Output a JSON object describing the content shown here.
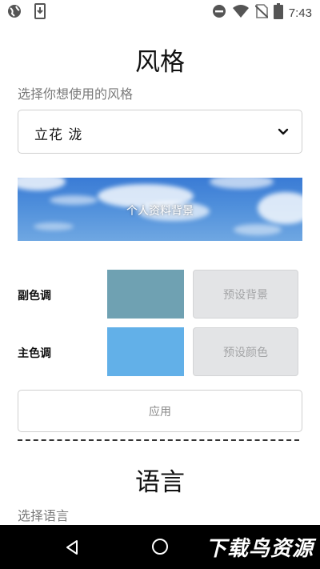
{
  "status_bar": {
    "time": "7:43",
    "icons_left": [
      "vpn-globe-icon",
      "download-icon"
    ],
    "icons_right": [
      "do-not-disturb-icon",
      "wifi-icon",
      "no-sim-icon",
      "battery-icon"
    ]
  },
  "style_section": {
    "title": "风格",
    "subtitle": "选择你想使用的风格",
    "selected_style": "立花 泷",
    "banner_label": "个人资料背景"
  },
  "color_rows": [
    {
      "label": "副色调",
      "swatch_color": "#6fa1b2",
      "button_label": "预设背景"
    },
    {
      "label": "主色调",
      "swatch_color": "#62b0e8",
      "button_label": "预设颜色"
    }
  ],
  "apply_label": "应用",
  "language_section": {
    "title": "语言",
    "subtitle": "选择语言"
  },
  "nav_bar": {
    "watermark": "下载鸟资源"
  },
  "colors": {
    "banner_sky": "#4f8fdb",
    "preset_button_bg": "#e3e4e6",
    "nav_bar_bg": "#000000"
  }
}
